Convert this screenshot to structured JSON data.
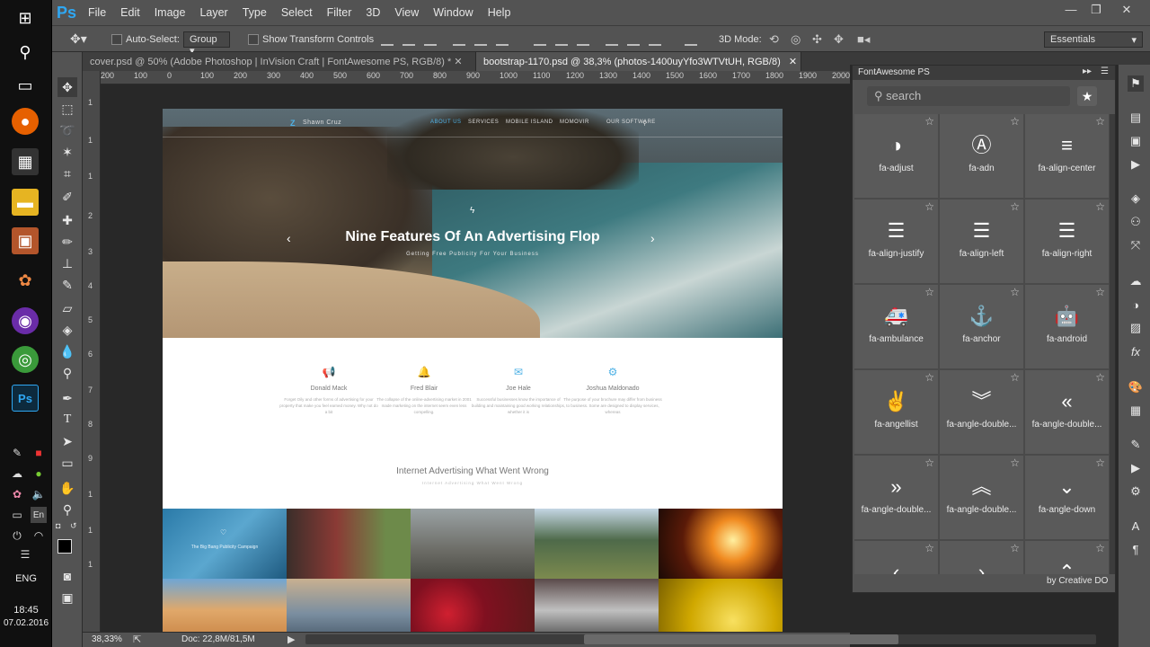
{
  "taskbar": {
    "language": "ENG",
    "time": "18:45",
    "date": "07.02.2016",
    "lang_indicator": "En"
  },
  "menubar": {
    "app_logo": "Ps",
    "items": [
      "File",
      "Edit",
      "Image",
      "Layer",
      "Type",
      "Select",
      "Filter",
      "3D",
      "View",
      "Window",
      "Help"
    ]
  },
  "options": {
    "auto_select_label": "Auto-Select:",
    "auto_select_value": "Group",
    "transform_label": "Show Transform Controls",
    "mode_3d_label": "3D Mode:",
    "workspace": "Essentials"
  },
  "tabs": [
    {
      "label": "cover.psd @ 50% (Adobe Photoshop | InVision Craft | FontAwesome PS, RGB/8) *",
      "active": false
    },
    {
      "label": "bootstrap-1170.psd @ 38,3% (photos-1400uyYfo3WTVtUH, RGB/8)",
      "active": true
    }
  ],
  "ruler": {
    "h_labels": [
      "200",
      "100",
      "0",
      "100",
      "200",
      "300",
      "400",
      "500",
      "600",
      "700",
      "800",
      "900",
      "1000",
      "1100",
      "1200",
      "1300",
      "1400",
      "1500",
      "1600",
      "1700",
      "1800",
      "1900",
      "2000"
    ],
    "v_labels": [
      "1",
      "1",
      "1",
      "2",
      "3",
      "4",
      "5",
      "6",
      "7",
      "8",
      "9",
      "1",
      "1",
      "1"
    ]
  },
  "document": {
    "brand": "Shawn Cruz",
    "nav": [
      "ABOUT US",
      "SERVICES",
      "MOBILE ISLAND",
      "MOMOVIR ",
      "OUR SOFTWARE"
    ],
    "hero_title": "Nine Features Of An Advertising Flop",
    "hero_subtitle": "Getting Free Publicity For Your Business",
    "features": [
      {
        "icon": "bullhorn-icon",
        "name": "Donald Mack",
        "text": "Forget Oily and other forms of advertising for your property that make you feel earned money. Why not do a bit"
      },
      {
        "icon": "bell-icon",
        "name": "Fred Blair",
        "text": "The collapse of the online-advertising market in 2001 made marketing on the internet seem even less compelling."
      },
      {
        "icon": "envelope-icon",
        "name": "Joe Hale",
        "text": "Successful businesses know the importance of building and maintaining good working relationships, whether it is"
      },
      {
        "icon": "cogs-icon",
        "name": "Joshua Maldonado",
        "text": "The purpose of your brochure may differ from business to business. Some are designed to display services, whereas"
      }
    ],
    "section_title": "Internet Advertising What Went Wrong",
    "section_subtitle": "Internet Advertising What Went Wrong",
    "photo_caption": "The Big Bang Publicity Campaign"
  },
  "fa_panel": {
    "title": "FontAwesome PS",
    "search_placeholder": "search",
    "footer": "by Creative DO",
    "icons": [
      {
        "name": "fa-adjust",
        "glyph": "◑"
      },
      {
        "name": "fa-adn",
        "glyph": "Ⓐ"
      },
      {
        "name": "fa-align-center",
        "glyph": "≡"
      },
      {
        "name": "fa-align-justify",
        "glyph": "☰"
      },
      {
        "name": "fa-align-left",
        "glyph": "☰"
      },
      {
        "name": "fa-align-right",
        "glyph": "☰"
      },
      {
        "name": "fa-ambulance",
        "glyph": "🚑"
      },
      {
        "name": "fa-anchor",
        "glyph": "⚓"
      },
      {
        "name": "fa-android",
        "glyph": "🤖"
      },
      {
        "name": "fa-angellist",
        "glyph": "✌"
      },
      {
        "name": "fa-angle-double...",
        "glyph": "︾"
      },
      {
        "name": "fa-angle-double...",
        "glyph": "«"
      },
      {
        "name": "fa-angle-double...",
        "glyph": "»"
      },
      {
        "name": "fa-angle-double...",
        "glyph": "︽"
      },
      {
        "name": "fa-angle-down",
        "glyph": "⌄"
      },
      {
        "name": "",
        "glyph": "‹"
      },
      {
        "name": "",
        "glyph": "›"
      },
      {
        "name": "",
        "glyph": "⌃"
      }
    ]
  },
  "status": {
    "zoom": "38,33%",
    "doc_info": "Doc: 22,8M/81,5M"
  },
  "colors": {
    "ps_blue": "#2fa7f2",
    "panel": "#535353",
    "accent": "#4fb2e6"
  }
}
